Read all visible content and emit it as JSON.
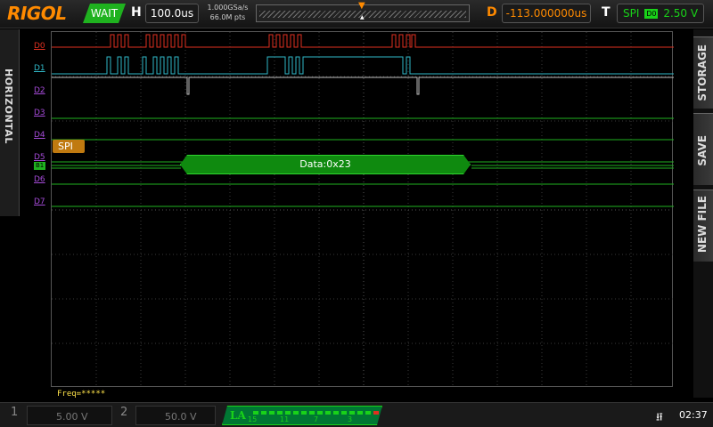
{
  "header": {
    "brand": "RIGOL",
    "run_status": "WAIT",
    "horizontal_label": "H",
    "timebase": "100.0us",
    "sample_rate": "1.000GSa/s",
    "memory_depth": "66.0M pts",
    "delay_label": "D",
    "delay_value": "-113.000000us",
    "trigger_label": "T",
    "trigger_type": "SPI",
    "trigger_source": "D0",
    "trigger_level": "2.50 V"
  },
  "left_tab": {
    "label": "HORIZONTAL"
  },
  "right_menu": {
    "items": [
      "STORAGE",
      "SAVE",
      "NEW FILE"
    ]
  },
  "channels": [
    "D0",
    "D1",
    "D2",
    "D3",
    "D4",
    "D5",
    "D6",
    "D7"
  ],
  "bus": {
    "label": "SPI",
    "marker": "B1",
    "decode_text": "Data:0x23"
  },
  "measure": {
    "freq": "Freq=*****"
  },
  "footer": {
    "ch1_num": "1",
    "ch1_scale": "5.00 V",
    "ch2_num": "2",
    "ch2_scale": "50.0 V",
    "la_label": "LA",
    "la_groups": [
      "15",
      "11",
      "7",
      "3"
    ],
    "time": "02:37"
  },
  "colors": {
    "accent": "#ff8a00",
    "d0": "#e03020",
    "d1": "#30b8c8",
    "bus": "#19d219",
    "decode": "#0f8a0f"
  }
}
